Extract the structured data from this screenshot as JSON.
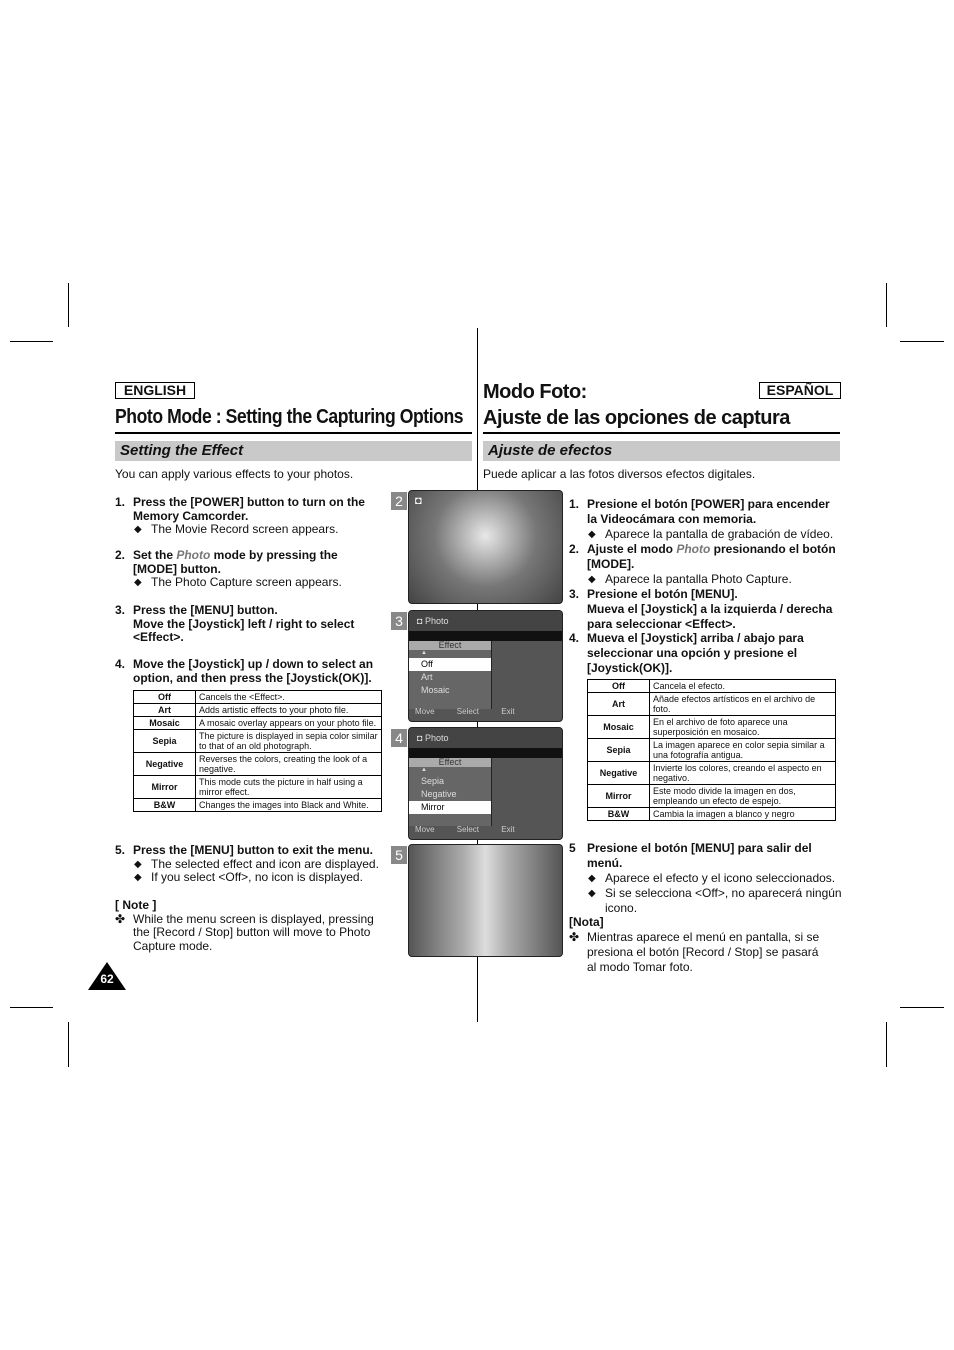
{
  "english": {
    "lang_badge": "ENGLISH",
    "title": "Photo Mode : Setting the Capturing Options",
    "section": "Setting the Effect",
    "intro": "You can apply various effects to your photos.",
    "steps": [
      {
        "num": "1.",
        "text": "Press the [POWER] button to turn on the Memory Camcorder.",
        "bullets": [
          "The Movie Record screen appears."
        ]
      },
      {
        "num": "2.",
        "pre": "Set the ",
        "em": "Photo",
        "post": " mode by pressing the [MODE] button.",
        "bullets": [
          "The Photo Capture screen appears."
        ]
      },
      {
        "num": "3.",
        "text": "Press the [MENU] button.",
        "text2": "Move the [Joystick] left / right to select <Effect>."
      },
      {
        "num": "4.",
        "text": "Move the [Joystick] up / down to select an option, and then press the [Joystick(OK)]."
      },
      {
        "num": "5.",
        "text": "Press the [MENU] button to exit the menu.",
        "bullets": [
          "The selected effect and icon are displayed.",
          "If you select <Off>, no icon is displayed."
        ]
      }
    ],
    "table": [
      [
        "Off",
        "Cancels the <Effect>."
      ],
      [
        "Art",
        "Adds artistic effects to your photo file."
      ],
      [
        "Mosaic",
        "A mosaic overlay appears on your photo file."
      ],
      [
        "Sepia",
        "The picture is displayed in sepia color similar to that of an old photograph."
      ],
      [
        "Negative",
        "Reverses the colors, creating the look of a negative."
      ],
      [
        "Mirror",
        "This mode cuts the picture in half using a mirror effect."
      ],
      [
        "B&W",
        "Changes the images into Black and White."
      ]
    ],
    "note_title": "[ Note ]",
    "note": "While the menu screen is displayed, pressing the [Record / Stop] button will move to Photo Capture mode.",
    "page_number": "62"
  },
  "espanol": {
    "lang_badge": "ESPAÑOL",
    "title1": "Modo Foto:",
    "title2": "Ajuste de las opciones de captura",
    "section": "Ajuste de efectos",
    "intro": "Puede aplicar a las fotos diversos efectos digitales.",
    "steps": [
      {
        "num": "1.",
        "text": "Presione el botón [POWER] para encender la Videocámara con memoria.",
        "bullets": [
          "Aparece la pantalla de grabación de vídeo."
        ]
      },
      {
        "num": "2.",
        "pre": "Ajuste el modo ",
        "em": "Photo",
        "post": " presionando el botón [MODE].",
        "bullets": [
          "Aparece la pantalla Photo Capture."
        ]
      },
      {
        "num": "3.",
        "text": "Presione el botón [MENU].",
        "text2": "Mueva el [Joystick] a la izquierda / derecha para seleccionar <Effect>."
      },
      {
        "num": "4.",
        "text": "Mueva el [Joystick] arriba / abajo para seleccionar una opción y presione el [Joystick(OK)]."
      },
      {
        "num": "5",
        "text": "Presione el botón [MENU] para salir del menú.",
        "bullets": [
          "Aparece el efecto y el icono seleccionados.",
          "Si se selecciona <Off>, no aparecerá ningún icono."
        ]
      }
    ],
    "table": [
      [
        "Off",
        "Cancela el efecto."
      ],
      [
        "Art",
        "Añade efectos artísticos en el archivo de foto."
      ],
      [
        "Mosaic",
        "En el archivo de foto aparece una superposición en mosaico."
      ],
      [
        "Sepia",
        "La imagen aparece en color sepia similar a una fotografía antigua."
      ],
      [
        "Negative",
        "Invierte los colores, creando el aspecto en negativo."
      ],
      [
        "Mirror",
        "Este modo divide la imagen en dos, empleando un efecto de espejo."
      ],
      [
        "B&W",
        "Cambia la imagen a blanco y negro"
      ]
    ],
    "note_title": "[Nota]",
    "note": "Mientras aparece el menú en pantalla, si se presiona el botón [Record / Stop] se pasará al modo Tomar foto."
  },
  "screens": {
    "labels": [
      "2",
      "3",
      "4",
      "5"
    ],
    "mode": "Photo",
    "menu_title": "Effect",
    "screen3_items": [
      "Off",
      "Art",
      "Mosaic"
    ],
    "screen4_items": [
      "Sepia",
      "Negative",
      "Mirror"
    ],
    "footer": {
      "move": "Move",
      "select": "Select",
      "exit": "Exit"
    }
  }
}
